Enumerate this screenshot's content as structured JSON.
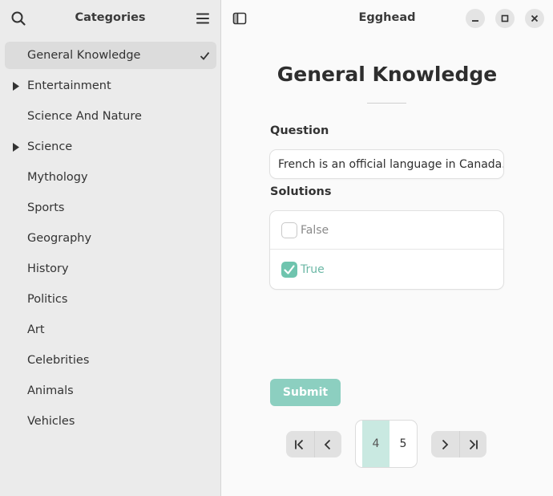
{
  "sidebar": {
    "title": "Categories",
    "items": [
      {
        "label": "General Knowledge",
        "selected": true,
        "expandable": false
      },
      {
        "label": "Entertainment",
        "selected": false,
        "expandable": true
      },
      {
        "label": "Science And Nature",
        "selected": false,
        "expandable": false
      },
      {
        "label": "Science",
        "selected": false,
        "expandable": true
      },
      {
        "label": "Mythology",
        "selected": false,
        "expandable": false
      },
      {
        "label": "Sports",
        "selected": false,
        "expandable": false
      },
      {
        "label": "Geography",
        "selected": false,
        "expandable": false
      },
      {
        "label": "History",
        "selected": false,
        "expandable": false
      },
      {
        "label": "Politics",
        "selected": false,
        "expandable": false
      },
      {
        "label": "Art",
        "selected": false,
        "expandable": false
      },
      {
        "label": "Celebrities",
        "selected": false,
        "expandable": false
      },
      {
        "label": "Animals",
        "selected": false,
        "expandable": false
      },
      {
        "label": "Vehicles",
        "selected": false,
        "expandable": false
      }
    ]
  },
  "window": {
    "title": "Egghead"
  },
  "main": {
    "title": "General Knowledge",
    "question_label": "Question",
    "question_text": "French is an official language in Canada.",
    "solutions_label": "Solutions",
    "solutions": [
      {
        "label": "False",
        "checked": false
      },
      {
        "label": "True",
        "checked": true
      }
    ],
    "submit_label": "Submit",
    "pages": {
      "current": "4",
      "next": "5"
    }
  },
  "colors": {
    "accent": "#6fc4ae",
    "submit_bg": "#8ccfc0",
    "current_page_bg": "#c9e9e1"
  }
}
